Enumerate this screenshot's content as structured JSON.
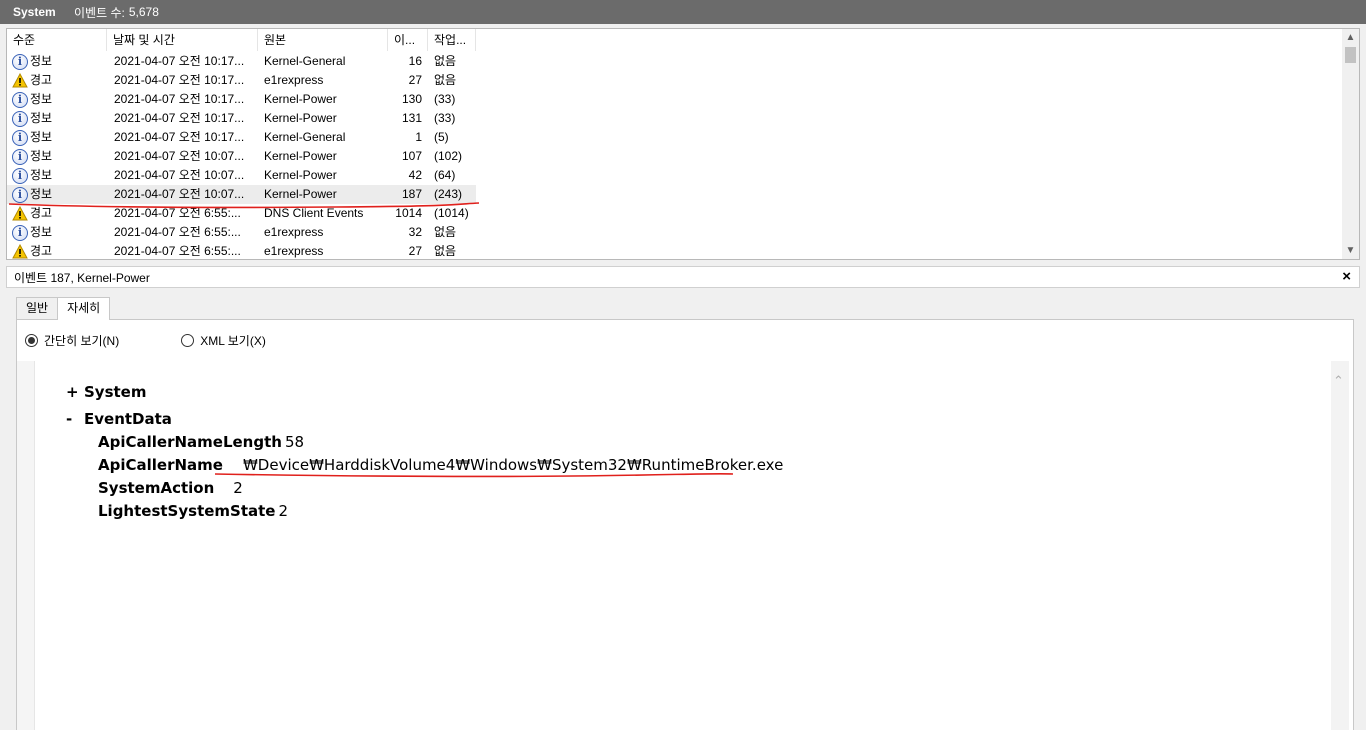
{
  "titlebar": {
    "log_name": "System",
    "count_label": "이벤트 수:",
    "count_value": "5,678"
  },
  "list": {
    "columns": [
      "수준",
      "날짜 및 시간",
      "원본",
      "이...",
      "작업..."
    ],
    "rows": [
      {
        "level": "정보",
        "icon": "info-icon",
        "date": "2021-04-07 오전 10:17...",
        "source": "Kernel-General",
        "id": "16",
        "task": "없음"
      },
      {
        "level": "경고",
        "icon": "warning-icon",
        "date": "2021-04-07 오전 10:17...",
        "source": "e1rexpress",
        "id": "27",
        "task": "없음"
      },
      {
        "level": "정보",
        "icon": "info-icon",
        "date": "2021-04-07 오전 10:17...",
        "source": "Kernel-Power",
        "id": "130",
        "task": "(33)"
      },
      {
        "level": "정보",
        "icon": "info-icon",
        "date": "2021-04-07 오전 10:17...",
        "source": "Kernel-Power",
        "id": "131",
        "task": "(33)"
      },
      {
        "level": "정보",
        "icon": "info-icon",
        "date": "2021-04-07 오전 10:17...",
        "source": "Kernel-General",
        "id": "1",
        "task": "(5)"
      },
      {
        "level": "정보",
        "icon": "info-icon",
        "date": "2021-04-07 오전 10:07...",
        "source": "Kernel-Power",
        "id": "107",
        "task": "(102)"
      },
      {
        "level": "정보",
        "icon": "info-icon",
        "date": "2021-04-07 오전 10:07...",
        "source": "Kernel-Power",
        "id": "42",
        "task": "(64)"
      },
      {
        "level": "정보",
        "icon": "info-icon",
        "date": "2021-04-07 오전 10:07...",
        "source": "Kernel-Power",
        "id": "187",
        "task": "(243)"
      },
      {
        "level": "경고",
        "icon": "warning-icon",
        "date": "2021-04-07 오전 6:55:...",
        "source": "DNS Client Events",
        "id": "1014",
        "task": "(1014)"
      },
      {
        "level": "정보",
        "icon": "info-icon",
        "date": "2021-04-07 오전 6:55:...",
        "source": "e1rexpress",
        "id": "32",
        "task": "없음"
      },
      {
        "level": "경고",
        "icon": "warning-icon",
        "date": "2021-04-07 오전 6:55:...",
        "source": "e1rexpress",
        "id": "27",
        "task": "없음"
      }
    ],
    "selected_index": 7
  },
  "detail": {
    "title": "이벤트 187, Kernel-Power",
    "close": "×",
    "tabs": [
      "일반",
      "자세히"
    ],
    "active_tab": "자세히",
    "radio_friendly": "간단히 보기(N)",
    "radio_xml": "XML 보기(X)",
    "tree": {
      "system": {
        "toggle": "+",
        "label": "System"
      },
      "eventdata": {
        "toggle": "-",
        "label": "EventData"
      },
      "fields": [
        {
          "key": "ApiCallerNameLength",
          "value": "58"
        },
        {
          "key": "ApiCallerName",
          "value": "₩Device₩HarddiskVolume4₩Windows₩System32₩RuntimeBroker.exe"
        },
        {
          "key": "SystemAction",
          "value": "2"
        },
        {
          "key": "LightestSystemState",
          "value": "2"
        }
      ]
    }
  },
  "colors": {
    "titlebar": "#6b6b6b",
    "annotation": "#e0201c",
    "info": "#3a63b8",
    "warning": "#f5c400"
  }
}
